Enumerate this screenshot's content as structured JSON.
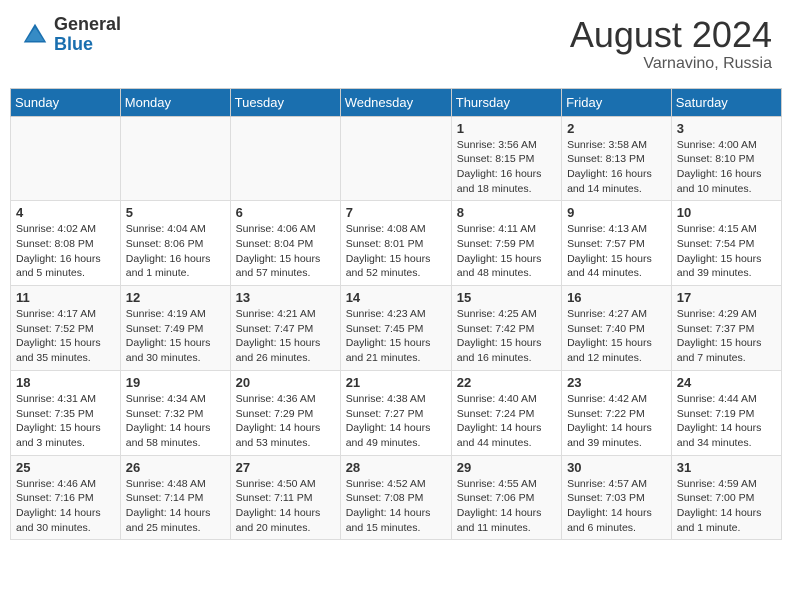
{
  "header": {
    "logo_general": "General",
    "logo_blue": "Blue",
    "month_year": "August 2024",
    "location": "Varnavino, Russia"
  },
  "days_of_week": [
    "Sunday",
    "Monday",
    "Tuesday",
    "Wednesday",
    "Thursday",
    "Friday",
    "Saturday"
  ],
  "weeks": [
    [
      {
        "day": "",
        "info": ""
      },
      {
        "day": "",
        "info": ""
      },
      {
        "day": "",
        "info": ""
      },
      {
        "day": "",
        "info": ""
      },
      {
        "day": "1",
        "info": "Sunrise: 3:56 AM\nSunset: 8:15 PM\nDaylight: 16 hours and 18 minutes."
      },
      {
        "day": "2",
        "info": "Sunrise: 3:58 AM\nSunset: 8:13 PM\nDaylight: 16 hours and 14 minutes."
      },
      {
        "day": "3",
        "info": "Sunrise: 4:00 AM\nSunset: 8:10 PM\nDaylight: 16 hours and 10 minutes."
      }
    ],
    [
      {
        "day": "4",
        "info": "Sunrise: 4:02 AM\nSunset: 8:08 PM\nDaylight: 16 hours and 5 minutes."
      },
      {
        "day": "5",
        "info": "Sunrise: 4:04 AM\nSunset: 8:06 PM\nDaylight: 16 hours and 1 minute."
      },
      {
        "day": "6",
        "info": "Sunrise: 4:06 AM\nSunset: 8:04 PM\nDaylight: 15 hours and 57 minutes."
      },
      {
        "day": "7",
        "info": "Sunrise: 4:08 AM\nSunset: 8:01 PM\nDaylight: 15 hours and 52 minutes."
      },
      {
        "day": "8",
        "info": "Sunrise: 4:11 AM\nSunset: 7:59 PM\nDaylight: 15 hours and 48 minutes."
      },
      {
        "day": "9",
        "info": "Sunrise: 4:13 AM\nSunset: 7:57 PM\nDaylight: 15 hours and 44 minutes."
      },
      {
        "day": "10",
        "info": "Sunrise: 4:15 AM\nSunset: 7:54 PM\nDaylight: 15 hours and 39 minutes."
      }
    ],
    [
      {
        "day": "11",
        "info": "Sunrise: 4:17 AM\nSunset: 7:52 PM\nDaylight: 15 hours and 35 minutes."
      },
      {
        "day": "12",
        "info": "Sunrise: 4:19 AM\nSunset: 7:49 PM\nDaylight: 15 hours and 30 minutes."
      },
      {
        "day": "13",
        "info": "Sunrise: 4:21 AM\nSunset: 7:47 PM\nDaylight: 15 hours and 26 minutes."
      },
      {
        "day": "14",
        "info": "Sunrise: 4:23 AM\nSunset: 7:45 PM\nDaylight: 15 hours and 21 minutes."
      },
      {
        "day": "15",
        "info": "Sunrise: 4:25 AM\nSunset: 7:42 PM\nDaylight: 15 hours and 16 minutes."
      },
      {
        "day": "16",
        "info": "Sunrise: 4:27 AM\nSunset: 7:40 PM\nDaylight: 15 hours and 12 minutes."
      },
      {
        "day": "17",
        "info": "Sunrise: 4:29 AM\nSunset: 7:37 PM\nDaylight: 15 hours and 7 minutes."
      }
    ],
    [
      {
        "day": "18",
        "info": "Sunrise: 4:31 AM\nSunset: 7:35 PM\nDaylight: 15 hours and 3 minutes."
      },
      {
        "day": "19",
        "info": "Sunrise: 4:34 AM\nSunset: 7:32 PM\nDaylight: 14 hours and 58 minutes."
      },
      {
        "day": "20",
        "info": "Sunrise: 4:36 AM\nSunset: 7:29 PM\nDaylight: 14 hours and 53 minutes."
      },
      {
        "day": "21",
        "info": "Sunrise: 4:38 AM\nSunset: 7:27 PM\nDaylight: 14 hours and 49 minutes."
      },
      {
        "day": "22",
        "info": "Sunrise: 4:40 AM\nSunset: 7:24 PM\nDaylight: 14 hours and 44 minutes."
      },
      {
        "day": "23",
        "info": "Sunrise: 4:42 AM\nSunset: 7:22 PM\nDaylight: 14 hours and 39 minutes."
      },
      {
        "day": "24",
        "info": "Sunrise: 4:44 AM\nSunset: 7:19 PM\nDaylight: 14 hours and 34 minutes."
      }
    ],
    [
      {
        "day": "25",
        "info": "Sunrise: 4:46 AM\nSunset: 7:16 PM\nDaylight: 14 hours and 30 minutes."
      },
      {
        "day": "26",
        "info": "Sunrise: 4:48 AM\nSunset: 7:14 PM\nDaylight: 14 hours and 25 minutes."
      },
      {
        "day": "27",
        "info": "Sunrise: 4:50 AM\nSunset: 7:11 PM\nDaylight: 14 hours and 20 minutes."
      },
      {
        "day": "28",
        "info": "Sunrise: 4:52 AM\nSunset: 7:08 PM\nDaylight: 14 hours and 15 minutes."
      },
      {
        "day": "29",
        "info": "Sunrise: 4:55 AM\nSunset: 7:06 PM\nDaylight: 14 hours and 11 minutes."
      },
      {
        "day": "30",
        "info": "Sunrise: 4:57 AM\nSunset: 7:03 PM\nDaylight: 14 hours and 6 minutes."
      },
      {
        "day": "31",
        "info": "Sunrise: 4:59 AM\nSunset: 7:00 PM\nDaylight: 14 hours and 1 minute."
      }
    ]
  ]
}
